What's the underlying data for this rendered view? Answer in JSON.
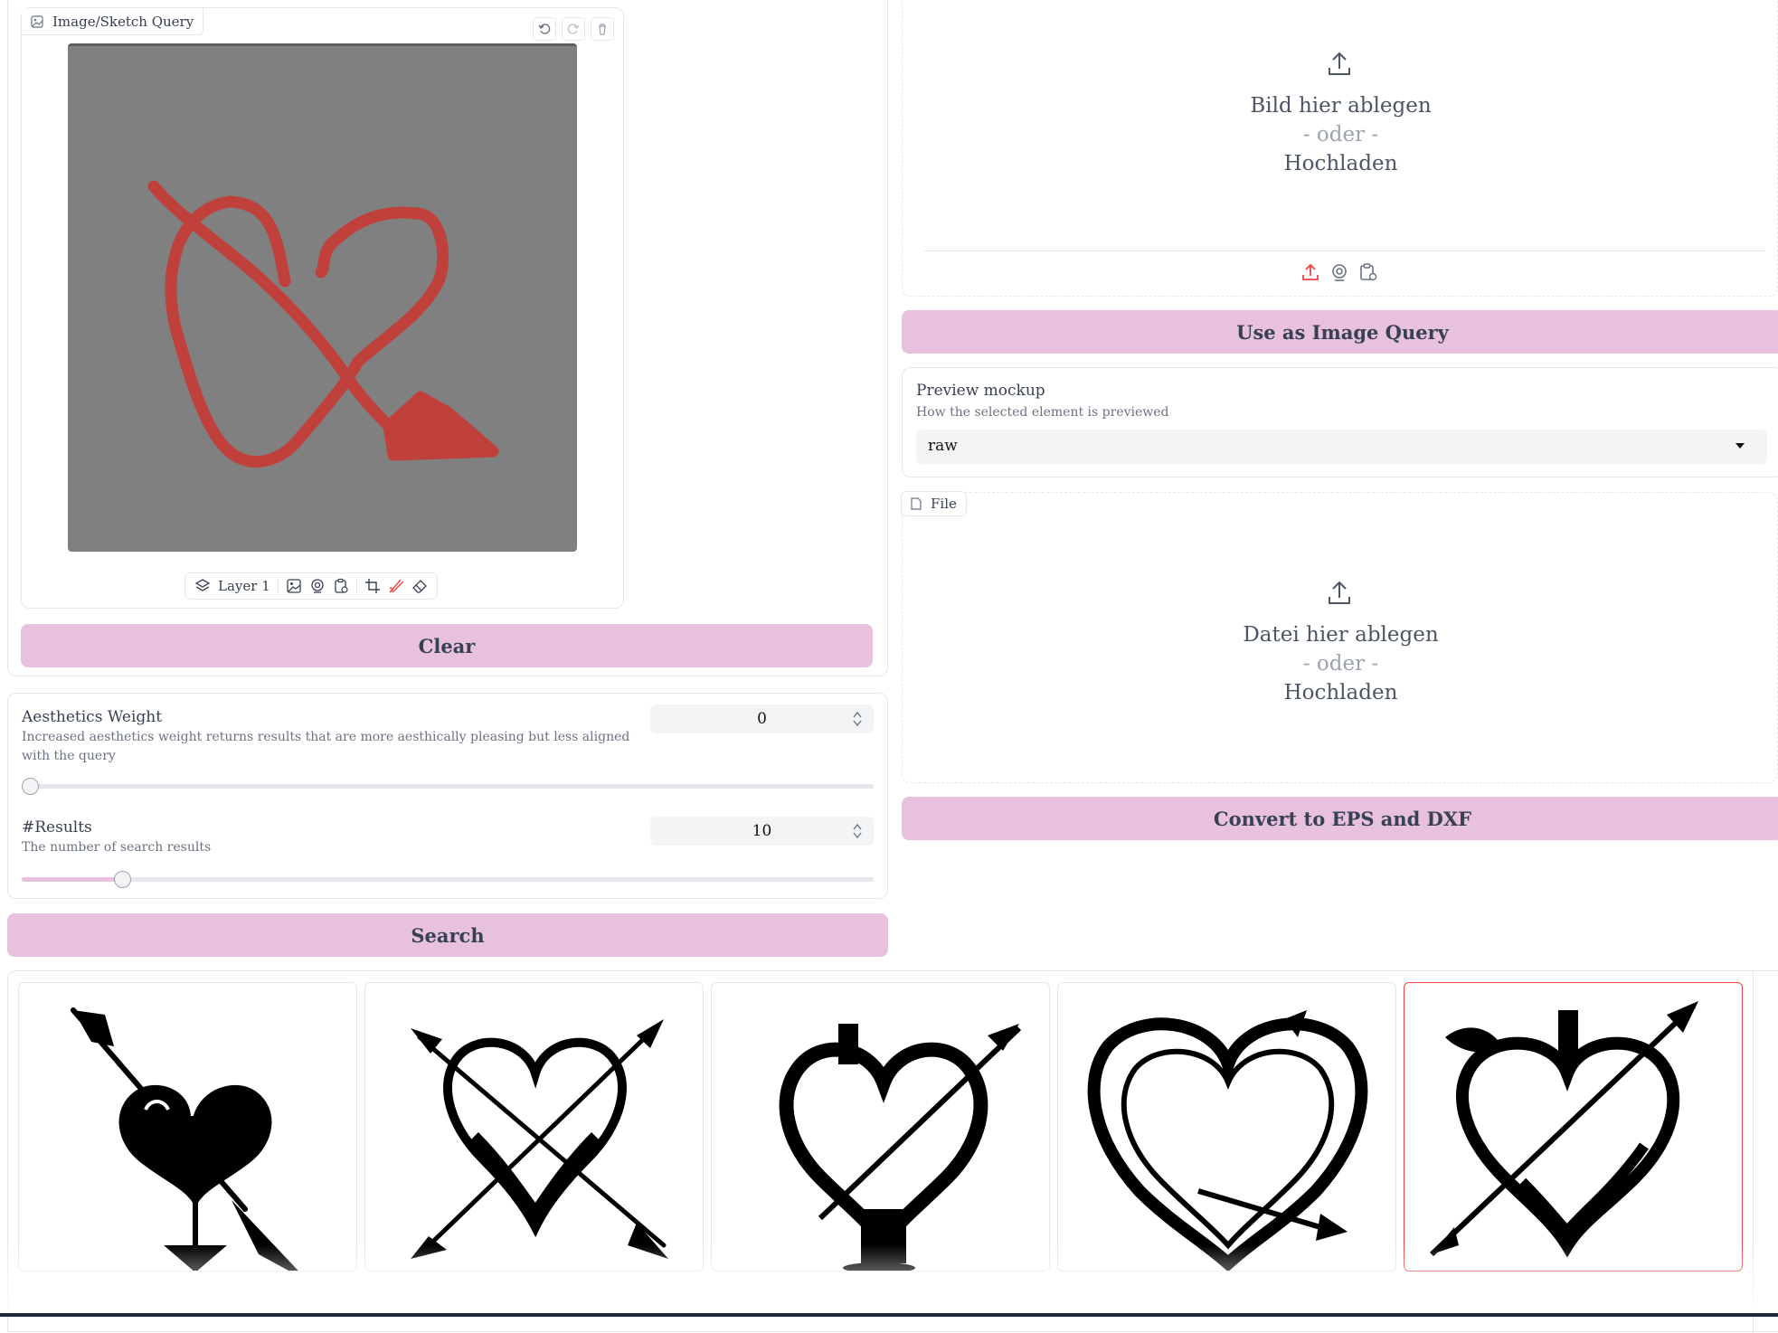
{
  "sketch": {
    "tab_label": "Image/Sketch Query",
    "layer_label": "Layer 1",
    "clear_label": "Clear"
  },
  "upload_image": {
    "line1": "Bild hier ablegen",
    "line2": "- oder -",
    "line3": "Hochladen"
  },
  "use_image_query_label": "Use as Image Query",
  "preview": {
    "label": "Preview mockup",
    "info": "How the selected element is previewed",
    "value": "raw"
  },
  "file_upload": {
    "tab_label": "File",
    "line1": "Datei hier ablegen",
    "line2": "- oder -",
    "line3": "Hochladen"
  },
  "convert_label": "Convert to EPS and DXF",
  "aesthetics": {
    "label": "Aesthetics Weight",
    "info": "Increased aesthetics weight returns results that are more aesthically pleasing but less aligned with the query",
    "value": "0",
    "fraction": 0
  },
  "results": {
    "label": "#Results",
    "info": "The number of search results",
    "value": "10",
    "fraction": 0.12
  },
  "search_label": "Search",
  "colors": {
    "accent_button": "#e8c1de",
    "sketch_canvas": "#808080",
    "sketch_stroke": "#c0413c",
    "selected_border": "#ef4444"
  }
}
